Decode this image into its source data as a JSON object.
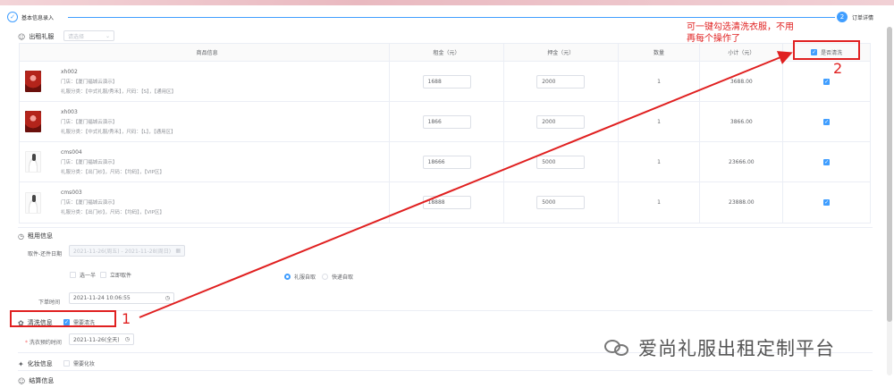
{
  "steps": {
    "left_label": "基本信息录入",
    "right_number": "2",
    "right_label": "订单详情"
  },
  "dress_section": {
    "title": "出租礼服",
    "select_placeholder": "请选择"
  },
  "table": {
    "headers": [
      "商品信息",
      "租金（元）",
      "押金（元）",
      "数量",
      "小计（元）",
      "是否清洗"
    ],
    "rows": [
      {
        "thumb": "red",
        "code": "xh002",
        "store": "门店：【厦门福城云演示】",
        "cat": "礼服分类：【中式礼服/秀禾】，尺码：【S】，【通用区】",
        "rent": "1688",
        "deposit": "2000",
        "qty": "1",
        "subtotal": "3688.00",
        "wash": true
      },
      {
        "thumb": "red",
        "code": "xh003",
        "store": "门店：【厦门福城云演示】",
        "cat": "礼服分类：【中式礼服/秀禾】，尺码：【L】，【通用区】",
        "rent": "1866",
        "deposit": "2000",
        "qty": "1",
        "subtotal": "3866.00",
        "wash": true
      },
      {
        "thumb": "white",
        "code": "cms004",
        "store": "门店：【厦门福城云演示】",
        "cat": "礼服分类：【出门纱】，尺码：【均码】，【VIP区】",
        "rent": "18666",
        "deposit": "5000",
        "qty": "1",
        "subtotal": "23666.00",
        "wash": true
      },
      {
        "thumb": "white",
        "code": "cms003",
        "store": "门店：【厦门福城云演示】",
        "cat": "礼服分类：【出门纱】，尺码：【均码】，【VIP区】",
        "rent": "18888",
        "deposit": "5000",
        "qty": "1",
        "subtotal": "23888.00",
        "wash": true
      }
    ]
  },
  "rental": {
    "title": "租用信息",
    "date_label": "取件-还件日期",
    "date_value": "2021-11-26(周五) - 2021-11-28(周日)",
    "opt_a": "选一半",
    "opt_b": "立即取件",
    "pick_a": "礼服自取",
    "pick_b": "快递自取",
    "order_time_label": "下单时间",
    "order_time_value": "2021-11-24 10:06:55"
  },
  "wash": {
    "title": "清洗信息",
    "need_wash_label": "需要清洗",
    "wash_date_label": "洗衣预约时间",
    "wash_date_value": "2021-11-26(全天)"
  },
  "makeup": {
    "title": "化妆信息",
    "need_label": "需要化妆"
  },
  "settle": {
    "title": "结算信息"
  },
  "annotation": {
    "note_line1": "可一键勾选清洗衣服，不用",
    "note_line2": "再每个操作了",
    "num1": "1",
    "num2": "2",
    "color": "#e02020"
  },
  "watermark": {
    "text": "爱尚礼服出租定制平台"
  },
  "colors": {
    "primary": "#409eff",
    "annotation": "#e02020"
  }
}
